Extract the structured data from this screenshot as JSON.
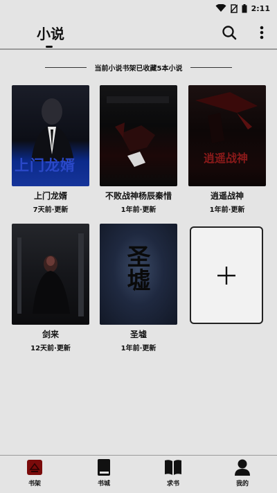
{
  "status": {
    "time": "2:11"
  },
  "header": {
    "title": "小说"
  },
  "shelf": {
    "banner": "当前小说书架已收藏5本小说"
  },
  "books": [
    {
      "title": "上门龙婿",
      "updated": "7天前·更新",
      "cover_text": "上门龙婿"
    },
    {
      "title": "不败战神杨辰秦惜",
      "updated": "1年前·更新",
      "cover_text": ""
    },
    {
      "title": "逍遥战神",
      "updated": "1年前·更新",
      "cover_text": "逍遥战神"
    },
    {
      "title": "剑来",
      "updated": "12天前·更新",
      "cover_text": ""
    },
    {
      "title": "圣墟",
      "updated": "1年前·更新",
      "cover_text": "圣墟"
    }
  ],
  "add_card": {
    "icon": "plus-icon"
  },
  "nav": [
    {
      "label": "书架",
      "icon": "bookshelf-icon",
      "active": true
    },
    {
      "label": "书城",
      "icon": "book-icon",
      "active": false
    },
    {
      "label": "求书",
      "icon": "open-book-icon",
      "active": false
    },
    {
      "label": "我的",
      "icon": "user-icon",
      "active": false
    }
  ],
  "colors": {
    "background": "#e4e4e4",
    "active_nav": "#7a0b0b",
    "text": "#111111"
  }
}
